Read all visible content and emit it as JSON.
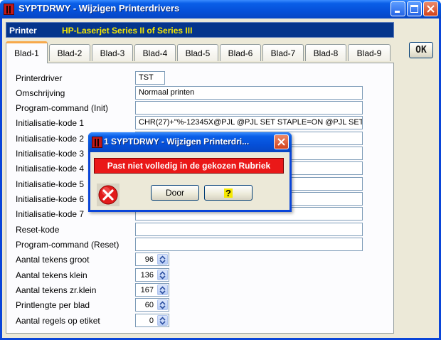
{
  "window": {
    "title": "SYPTDRWY - Wijzigen Printerdrivers"
  },
  "printer": {
    "label": "Printer",
    "value": "HP-Laserjet Series II of Series III"
  },
  "ok_label": "OK",
  "tabs": [
    {
      "label": "Blad-1",
      "active": true
    },
    {
      "label": "Blad-2"
    },
    {
      "label": "Blad-3"
    },
    {
      "label": "Blad-4"
    },
    {
      "label": "Blad-5"
    },
    {
      "label": "Blad-6"
    },
    {
      "label": "Blad-7"
    },
    {
      "label": "Blad-8"
    },
    {
      "label": "Blad-9"
    }
  ],
  "form": {
    "printerdriver": {
      "label": "Printerdriver",
      "value": "TST"
    },
    "omschrijving": {
      "label": "Omschrijving",
      "value": "Normaal printen"
    },
    "program_init": {
      "label": "Program-command (Init)",
      "value": ""
    },
    "init": [
      {
        "label": "Initialisatie-kode 1",
        "value": "CHR(27)+\"%-12345X@PJL @PJL SET STAPLE=ON @PJL SET S"
      },
      {
        "label": "Initialisatie-kode 2",
        "value": ""
      },
      {
        "label": "Initialisatie-kode 3",
        "value": ""
      },
      {
        "label": "Initialisatie-kode 4",
        "value": ""
      },
      {
        "label": "Initialisatie-kode 5",
        "value": ""
      },
      {
        "label": "Initialisatie-kode 6",
        "value": ""
      },
      {
        "label": "Initialisatie-kode 7",
        "value": ""
      }
    ],
    "reset_kode": {
      "label": "Reset-kode",
      "value": ""
    },
    "program_reset": {
      "label": "Program-command (Reset)",
      "value": ""
    },
    "numbers": [
      {
        "label": "Aantal tekens groot",
        "value": "96"
      },
      {
        "label": "Aantal tekens klein",
        "value": "136"
      },
      {
        "label": "Aantal tekens zr.klein",
        "value": "167"
      },
      {
        "label": "Printlengte per blad",
        "value": "60"
      },
      {
        "label": "Aantal regels op etiket",
        "value": "0"
      }
    ]
  },
  "dialog": {
    "title": "1 SYPTDRWY - Wijzigen Printerdri...",
    "message": "Past niet volledig in de gekozen Rubriek",
    "door_label": "Door",
    "help_label": "?"
  },
  "colors": {
    "title_blue": "#0550d9",
    "printer_bar": "#05358c",
    "printer_value": "#f5e800",
    "error_red": "#ea1818",
    "tab_accent": "#f7a94b"
  }
}
